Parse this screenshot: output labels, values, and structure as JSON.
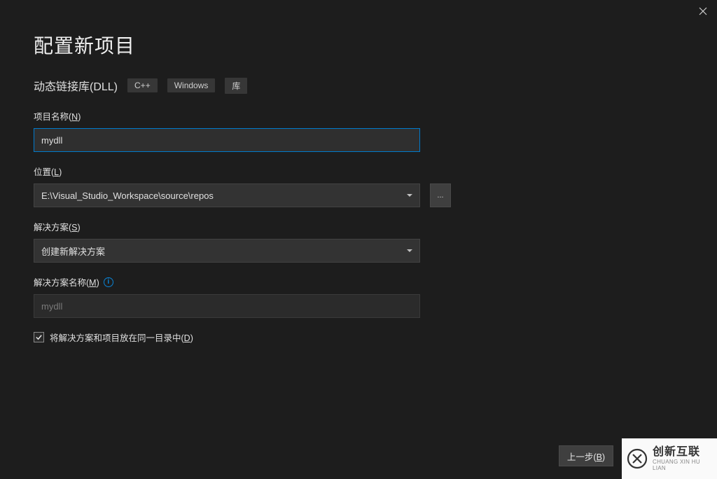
{
  "header": {
    "title": "配置新项目",
    "subtitle": "动态链接库(DLL)",
    "tags": [
      "C++",
      "Windows",
      "库"
    ]
  },
  "fields": {
    "project_name": {
      "label_pre": "项目名称(",
      "label_key": "N",
      "label_post": ")",
      "value": "mydll"
    },
    "location": {
      "label_pre": "位置(",
      "label_key": "L",
      "label_post": ")",
      "value": "E:\\Visual_Studio_Workspace\\source\\repos",
      "browse": "..."
    },
    "solution": {
      "label_pre": "解决方案(",
      "label_key": "S",
      "label_post": ")",
      "value": "创建新解决方案"
    },
    "solution_name": {
      "label_pre": "解决方案名称(",
      "label_key": "M",
      "label_post": ")",
      "value": "mydll"
    },
    "same_dir": {
      "label_pre": "将解决方案和项目放在同一目录中(",
      "label_key": "D",
      "label_post": ")",
      "checked": true
    }
  },
  "footer": {
    "back_pre": "上一步(",
    "back_key": "B",
    "back_post": ")"
  },
  "logo": {
    "cn": "创新互联",
    "en": "CHUANG XIN HU LIAN"
  }
}
